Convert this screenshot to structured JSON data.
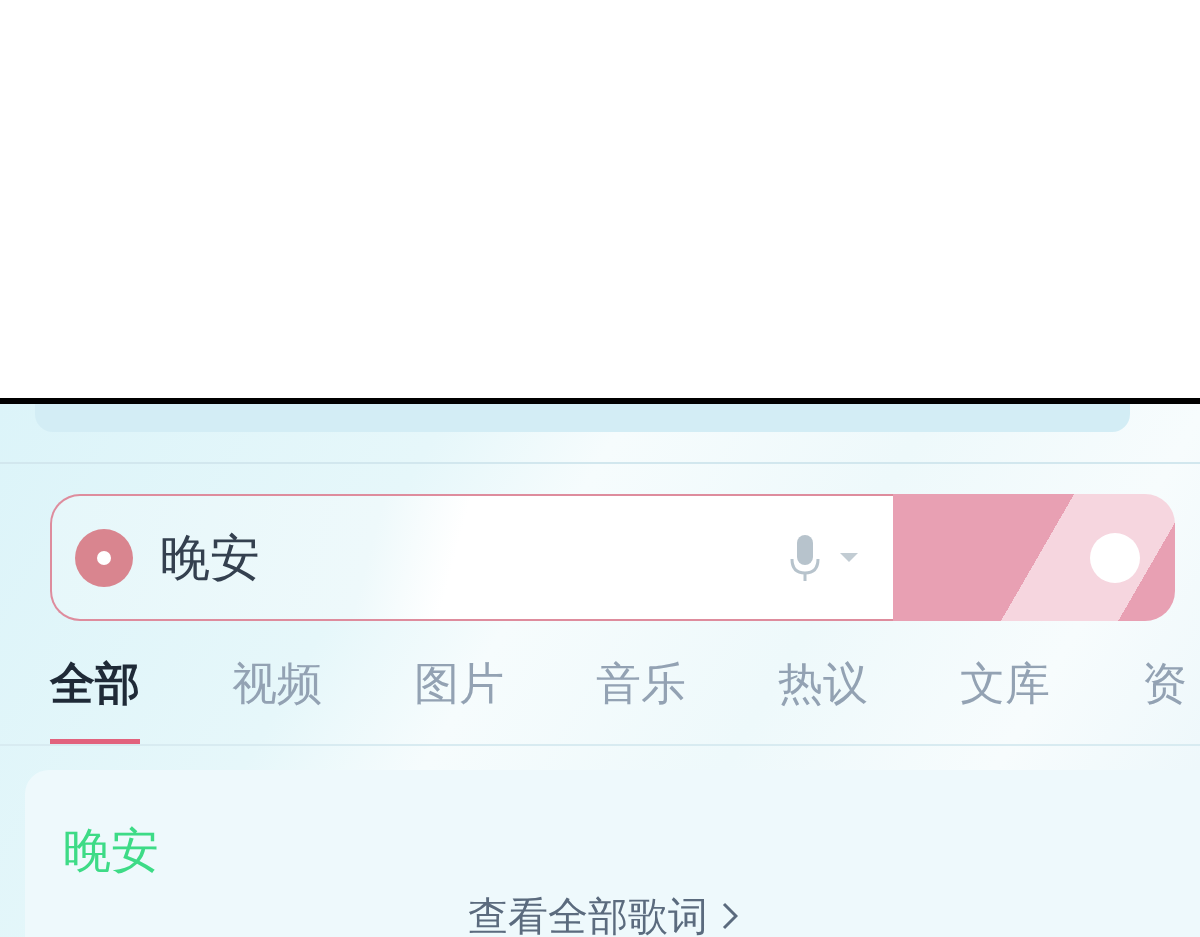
{
  "search": {
    "value": "晚安"
  },
  "tabs": [
    {
      "label": "全部",
      "selected": true
    },
    {
      "label": "视频",
      "selected": false
    },
    {
      "label": "图片",
      "selected": false
    },
    {
      "label": "音乐",
      "selected": false
    },
    {
      "label": "热议",
      "selected": false
    },
    {
      "label": "文库",
      "selected": false
    },
    {
      "label": "资",
      "selected": false
    }
  ],
  "result": {
    "title": "晚安",
    "link": "查看全部歌词"
  }
}
